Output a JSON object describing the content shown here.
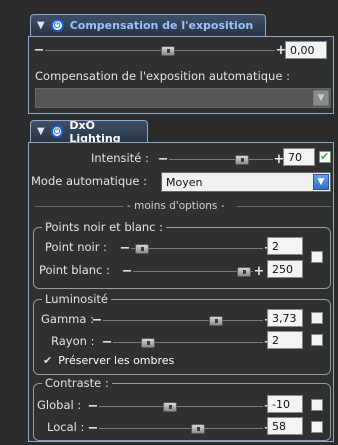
{
  "exposure": {
    "title": "Compensation de l'exposition",
    "value": "0,00",
    "auto_label": "Compensation de l'exposition automatique :",
    "auto_value": "",
    "slider_pos": 0.5
  },
  "lighting": {
    "title": "DxO Lighting",
    "intensity_label": "Intensité :",
    "intensity_value": "70",
    "intensity_pos": 0.66,
    "intensity_checked": true,
    "mode_label": "Mode automatique :",
    "mode_value": "Moyen",
    "less_options": "- moins d'options -"
  },
  "points": {
    "legend": "Points noir et blanc :",
    "black_label": "Point noir :",
    "black_value": "2",
    "black_pos": 0.03,
    "white_label": "Point blanc :",
    "white_value": "250",
    "white_pos": 0.92
  },
  "luminosity": {
    "legend": "Luminosité",
    "gamma_label": "Gamma :",
    "gamma_value": "3,73",
    "gamma_pos": 0.68,
    "rayon_label": "Rayon :",
    "rayon_value": "2",
    "rayon_pos": 0.2,
    "preserve_label": "Préserver les ombres"
  },
  "contrast": {
    "legend": "Contraste :",
    "global_label": "Global :",
    "global_value": "-10",
    "global_pos": 0.41,
    "local_label": "Local :",
    "local_value": "58",
    "local_pos": 0.6
  }
}
